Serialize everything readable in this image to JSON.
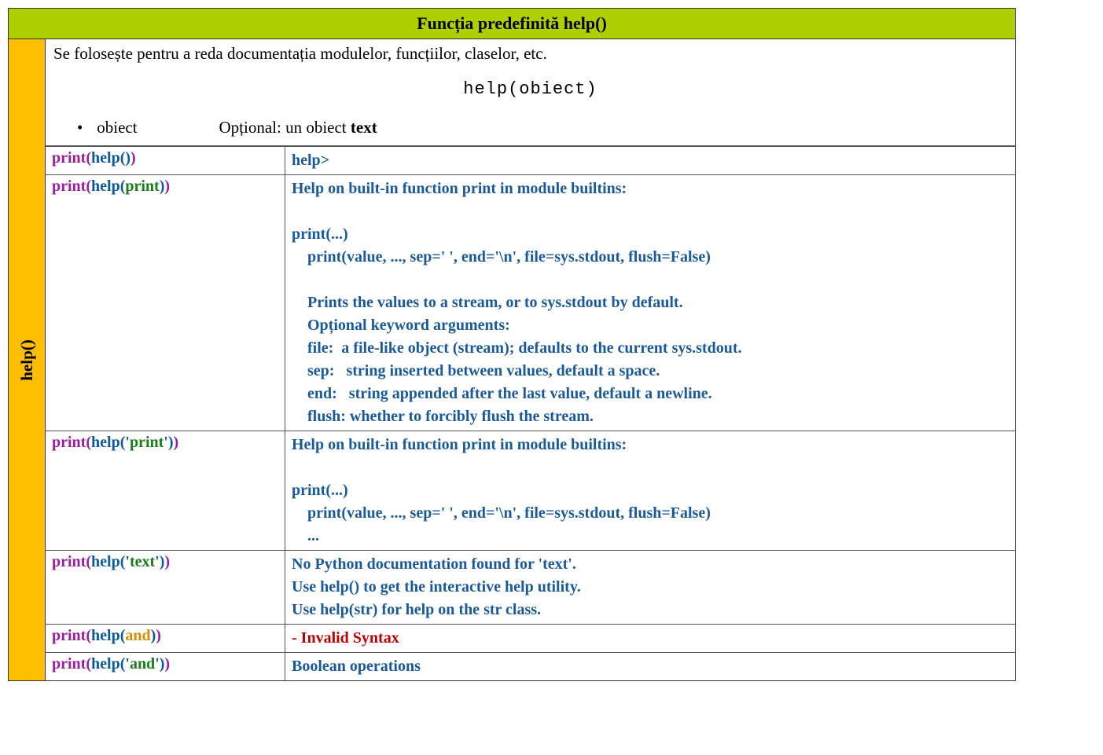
{
  "title": "Funcția predefinită help()",
  "side_label": "help()",
  "intro": {
    "desc": "Se folosește pentru a reda documentația modulelor, funcțiilor, claselor, etc.",
    "syntax": "help(obiect)",
    "param_name": "obiect",
    "param_desc_prefix": "Opțional: un obiect ",
    "param_desc_bold": "text"
  },
  "rows": {
    "r0": {
      "code": {
        "fn": "print",
        "inner": "help",
        "arg": "",
        "arg_color": "",
        "quoted": false
      },
      "out_class": "out-blue",
      "out": "help>"
    },
    "r1": {
      "code": {
        "fn": "print",
        "inner": "help",
        "arg": "print",
        "arg_color": "kw-arg",
        "quoted": false
      },
      "out_class": "out-blue",
      "out": "Help on built-in function print in module builtins:\n\nprint(...)\n    print(value, ..., sep=' ', end='\\n', file=sys.stdout, flush=False)\n\n    Prints the values to a stream, or to sys.stdout by default.\n    Opțional keyword arguments:\n    file:  a file-like object (stream); defaults to the current sys.stdout.\n    sep:   string inserted between values, default a space.\n    end:   string appended after the last value, default a newline.\n    flush: whether to forcibly flush the stream."
    },
    "r2": {
      "code": {
        "fn": "print",
        "inner": "help",
        "arg": "print",
        "arg_color": "kw-arg",
        "quoted": true
      },
      "out_class": "out-blue",
      "out": "Help on built-in function print in module builtins:\n\nprint(...)\n    print(value, ..., sep=' ', end='\\n', file=sys.stdout, flush=False)\n    ..."
    },
    "r3": {
      "code": {
        "fn": "print",
        "inner": "help",
        "arg": "text",
        "arg_color": "kw-arg",
        "quoted": true
      },
      "out_class": "out-blue",
      "out": "No Python documentation found for 'text'.\nUse help() to get the interactive help utility.\nUse help(str) for help on the str class."
    },
    "r4": {
      "code": {
        "fn": "print",
        "inner": "help",
        "arg": "and",
        "arg_color": "kw-and",
        "quoted": false
      },
      "out_class": "out-red",
      "out": "- Invalid Syntax"
    },
    "r5": {
      "code": {
        "fn": "print",
        "inner": "help",
        "arg": "and",
        "arg_color": "kw-arg",
        "quoted": true
      },
      "out_class": "out-blue",
      "out": "Boolean operations"
    }
  }
}
